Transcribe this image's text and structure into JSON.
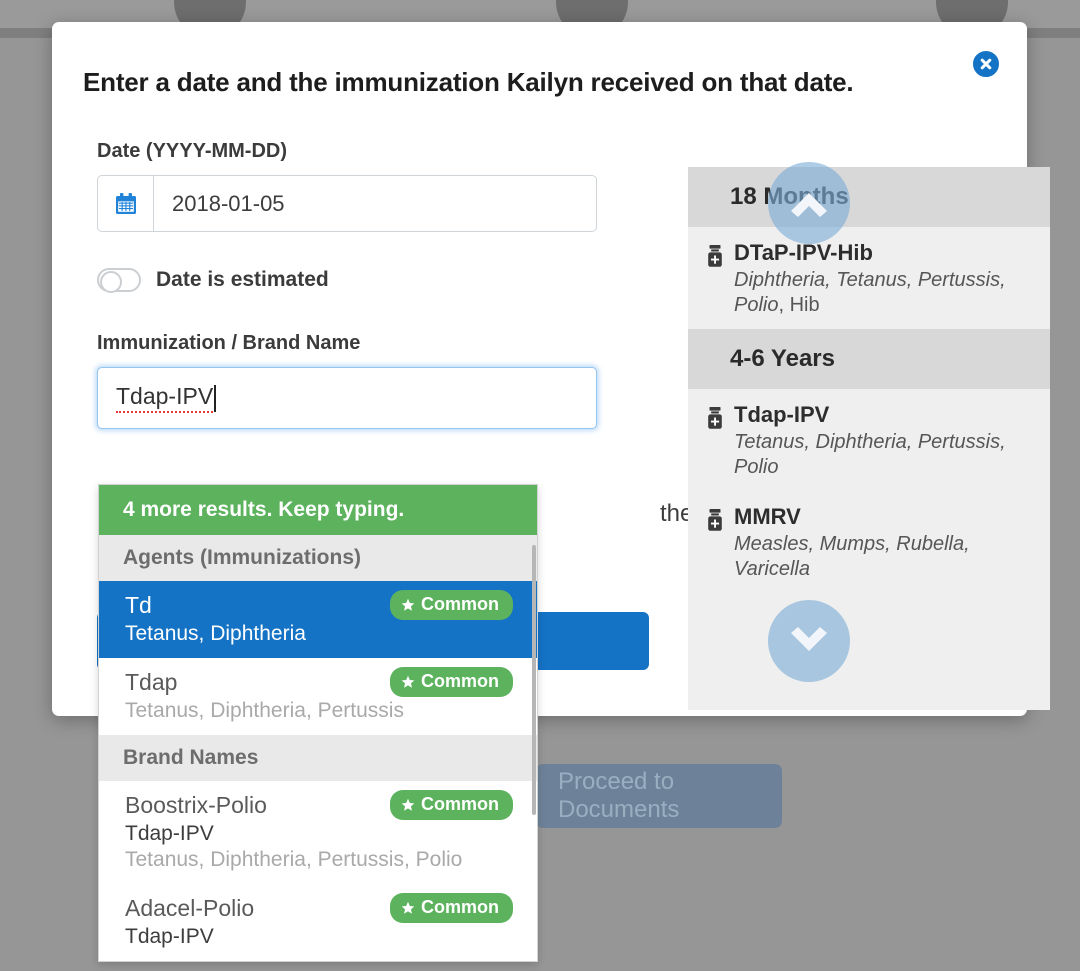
{
  "background": {
    "button_label": "Proceed to Documents"
  },
  "modal": {
    "title": "Enter a date and the immunization Kailyn received on that date.",
    "close_label": "Close",
    "date_label": "Date (YYYY-MM-DD)",
    "date_value": "2018-01-05",
    "date_icon": "calendar-icon",
    "estimated_toggle_label": "Date is estimated",
    "estimated_toggle_state": "off",
    "immunization_label": "Immunization / Brand Name",
    "immunization_value": "Tdap-IPV",
    "then_text": "then",
    "accent_blue": "#1573c6",
    "accent_green": "#5cb25d"
  },
  "dropdown": {
    "banner": "4 more results. Keep typing.",
    "groups": [
      {
        "title": "Agents (Immunizations)",
        "items": [
          {
            "name": "Td",
            "agents": "",
            "components": "Tetanus, Diphtheria",
            "badge": "Common",
            "selected": true
          },
          {
            "name": "Tdap",
            "agents": "",
            "components": "Tetanus, Diphtheria, Pertussis",
            "badge": "Common",
            "selected": false
          }
        ]
      },
      {
        "title": "Brand Names",
        "items": [
          {
            "name": "Boostrix-Polio",
            "agents": "Tdap-IPV",
            "components": "Tetanus, Diphtheria, Pertussis, Polio",
            "badge": "Common",
            "selected": false
          },
          {
            "name": "Adacel-Polio",
            "agents": "Tdap-IPV",
            "components": "",
            "badge": "Common",
            "selected": false
          }
        ]
      }
    ]
  },
  "schedule": {
    "sections": [
      {
        "heading": "18 Months",
        "items": [
          {
            "name": "DTaP-IPV-Hib",
            "desc_italic": "Diphtheria, Tetanus, Pertussis, Polio",
            "desc_plain": ", Hib",
            "icon": "vaccine-bottle-icon"
          }
        ]
      },
      {
        "heading": "4-6 Years",
        "items": [
          {
            "name": "Tdap-IPV",
            "desc_italic": "Tetanus, Diphtheria, Pertussis, Polio",
            "desc_plain": "",
            "icon": "vaccine-bottle-icon"
          },
          {
            "name": "MMRV",
            "desc_italic": "Measles, Mumps, Rubella, Varicella",
            "desc_plain": "",
            "icon": "vaccine-bottle-icon"
          }
        ]
      }
    ],
    "scroll_up_label": "Scroll up",
    "scroll_down_label": "Scroll down"
  }
}
